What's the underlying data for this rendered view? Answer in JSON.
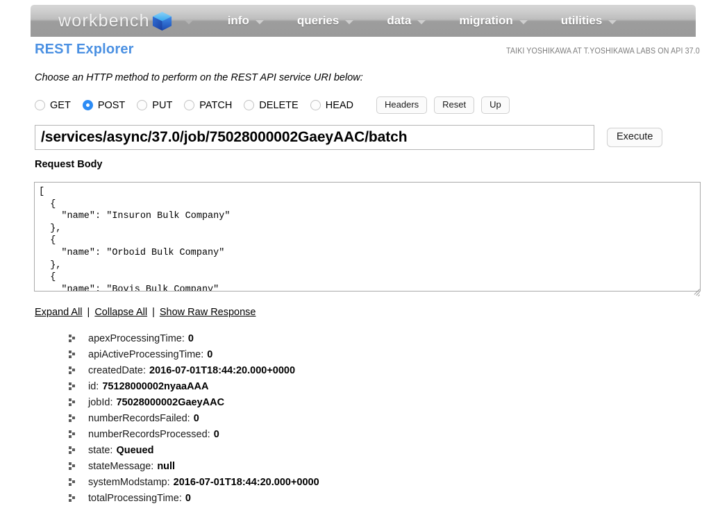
{
  "navbar": {
    "brand": "workbench",
    "brand_icon": "blue-cube-logo",
    "brand_caret": "chevron-down-icon",
    "menu": [
      {
        "label": "info"
      },
      {
        "label": "queries"
      },
      {
        "label": "data"
      },
      {
        "label": "migration"
      },
      {
        "label": "utilities"
      }
    ]
  },
  "header": {
    "title": "REST Explorer",
    "user_info": "TAIKI YOSHIKAWA AT T.YOSHIKAWA LABS ON API 37.0",
    "accent_color": "#4a90e2"
  },
  "instruction": "Choose an HTTP method to perform on the REST API service URI below:",
  "methods": {
    "selected": "POST",
    "selected_color": "#2d8cf5",
    "options": [
      {
        "label": "GET",
        "checked": false
      },
      {
        "label": "POST",
        "checked": true
      },
      {
        "label": "PUT",
        "checked": false
      },
      {
        "label": "PATCH",
        "checked": false
      },
      {
        "label": "DELETE",
        "checked": false
      },
      {
        "label": "HEAD",
        "checked": false
      }
    ],
    "buttons": [
      {
        "label": "Headers"
      },
      {
        "label": "Reset"
      },
      {
        "label": "Up"
      }
    ]
  },
  "uri": {
    "value": "/services/async/37.0/job/75028000002GaeyAAC/batch",
    "execute_label": "Execute"
  },
  "request_body": {
    "label": "Request Body",
    "value": "[\n  {\n    \"name\": \"Insuron Bulk Company\"\n  },\n  {\n    \"name\": \"Orboid Bulk Company\"\n  },\n  {\n    \"name\": \"Bovis Bulk Company\"\n  },"
  },
  "response_links": [
    {
      "label": "Expand All"
    },
    {
      "label": "Collapse All"
    },
    {
      "label": "Show Raw Response"
    }
  ],
  "link_separator": "|",
  "response_tree": [
    {
      "key": "apexProcessingTime:",
      "value": "0"
    },
    {
      "key": "apiActiveProcessingTime:",
      "value": "0"
    },
    {
      "key": "createdDate:",
      "value": "2016-07-01T18:44:20.000+0000"
    },
    {
      "key": "id:",
      "value": "75128000002nyaaAAA"
    },
    {
      "key": "jobId:",
      "value": "75028000002GaeyAAC"
    },
    {
      "key": "numberRecordsFailed:",
      "value": "0"
    },
    {
      "key": "numberRecordsProcessed:",
      "value": "0"
    },
    {
      "key": "state:",
      "value": "Queued"
    },
    {
      "key": "stateMessage:",
      "value": "null"
    },
    {
      "key": "systemModstamp:",
      "value": "2016-07-01T18:44:20.000+0000"
    },
    {
      "key": "totalProcessingTime:",
      "value": "0"
    }
  ]
}
